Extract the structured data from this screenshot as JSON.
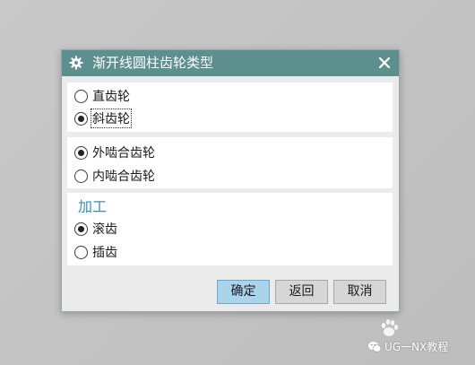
{
  "dialog": {
    "title": "渐开线圆柱齿轮类型",
    "title_icon": "gear-icon",
    "close_icon": "close-icon"
  },
  "groups": {
    "tooth_type": {
      "options": [
        {
          "label": "直齿轮",
          "checked": false
        },
        {
          "label": "斜齿轮",
          "checked": true
        }
      ]
    },
    "mesh_type": {
      "options": [
        {
          "label": "外啮合齿轮",
          "checked": true
        },
        {
          "label": "内啮合齿轮",
          "checked": false
        }
      ]
    },
    "machining": {
      "title": "加工",
      "options": [
        {
          "label": "滚齿",
          "checked": true
        },
        {
          "label": "插齿",
          "checked": false
        }
      ]
    }
  },
  "buttons": {
    "ok": "确定",
    "back": "返回",
    "cancel": "取消"
  },
  "watermark": {
    "text": "UG一NX教程"
  },
  "colors": {
    "titlebar": "#5e8f8f",
    "section_title": "#3b8fb0",
    "ok_button": "#a9d4ec"
  }
}
